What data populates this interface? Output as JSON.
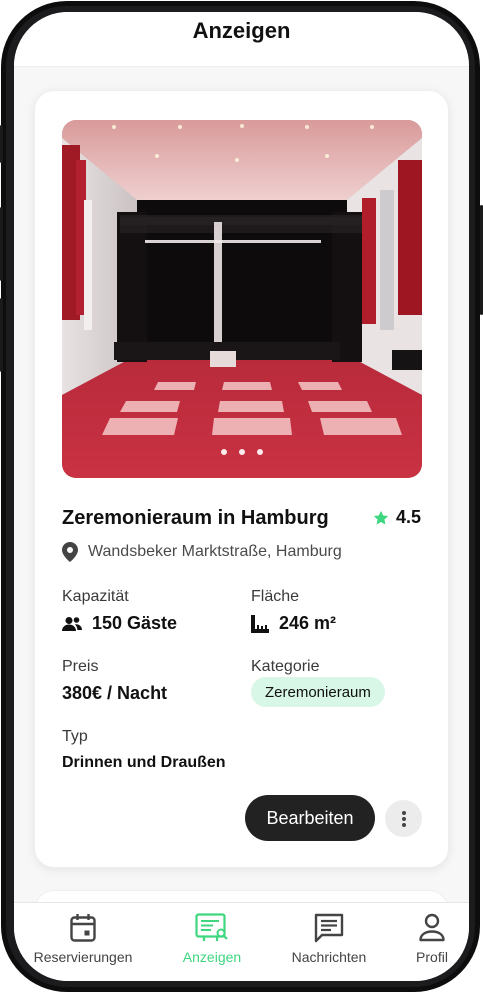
{
  "header": {
    "title": "Anzeigen"
  },
  "listing": {
    "title": "Zeremonieraum in Hamburg",
    "rating": "4.5",
    "address": "Wandsbeker Marktstraße, Hamburg",
    "image_dots": 3,
    "capacity": {
      "label": "Kapazität",
      "value": "150 Gäste"
    },
    "area": {
      "label": "Fläche",
      "value": "246 m²"
    },
    "price": {
      "label": "Preis",
      "value": "380€ / Nacht"
    },
    "category": {
      "label": "Kategorie",
      "value": "Zeremonieraum"
    },
    "type": {
      "label": "Typ",
      "value": "Drinnen und Draußen"
    },
    "edit_label": "Bearbeiten"
  },
  "tabs": [
    {
      "label": "Reservierungen",
      "icon": "calendar-icon",
      "active": false
    },
    {
      "label": "Anzeigen",
      "icon": "listing-icon",
      "active": true
    },
    {
      "label": "Nachrichten",
      "icon": "message-icon",
      "active": false
    },
    {
      "label": "Profil",
      "icon": "user-icon",
      "active": false
    }
  ],
  "colors": {
    "accent": "#3ED67F",
    "badge_bg": "#D9F7E6",
    "button_dark": "#222222"
  }
}
